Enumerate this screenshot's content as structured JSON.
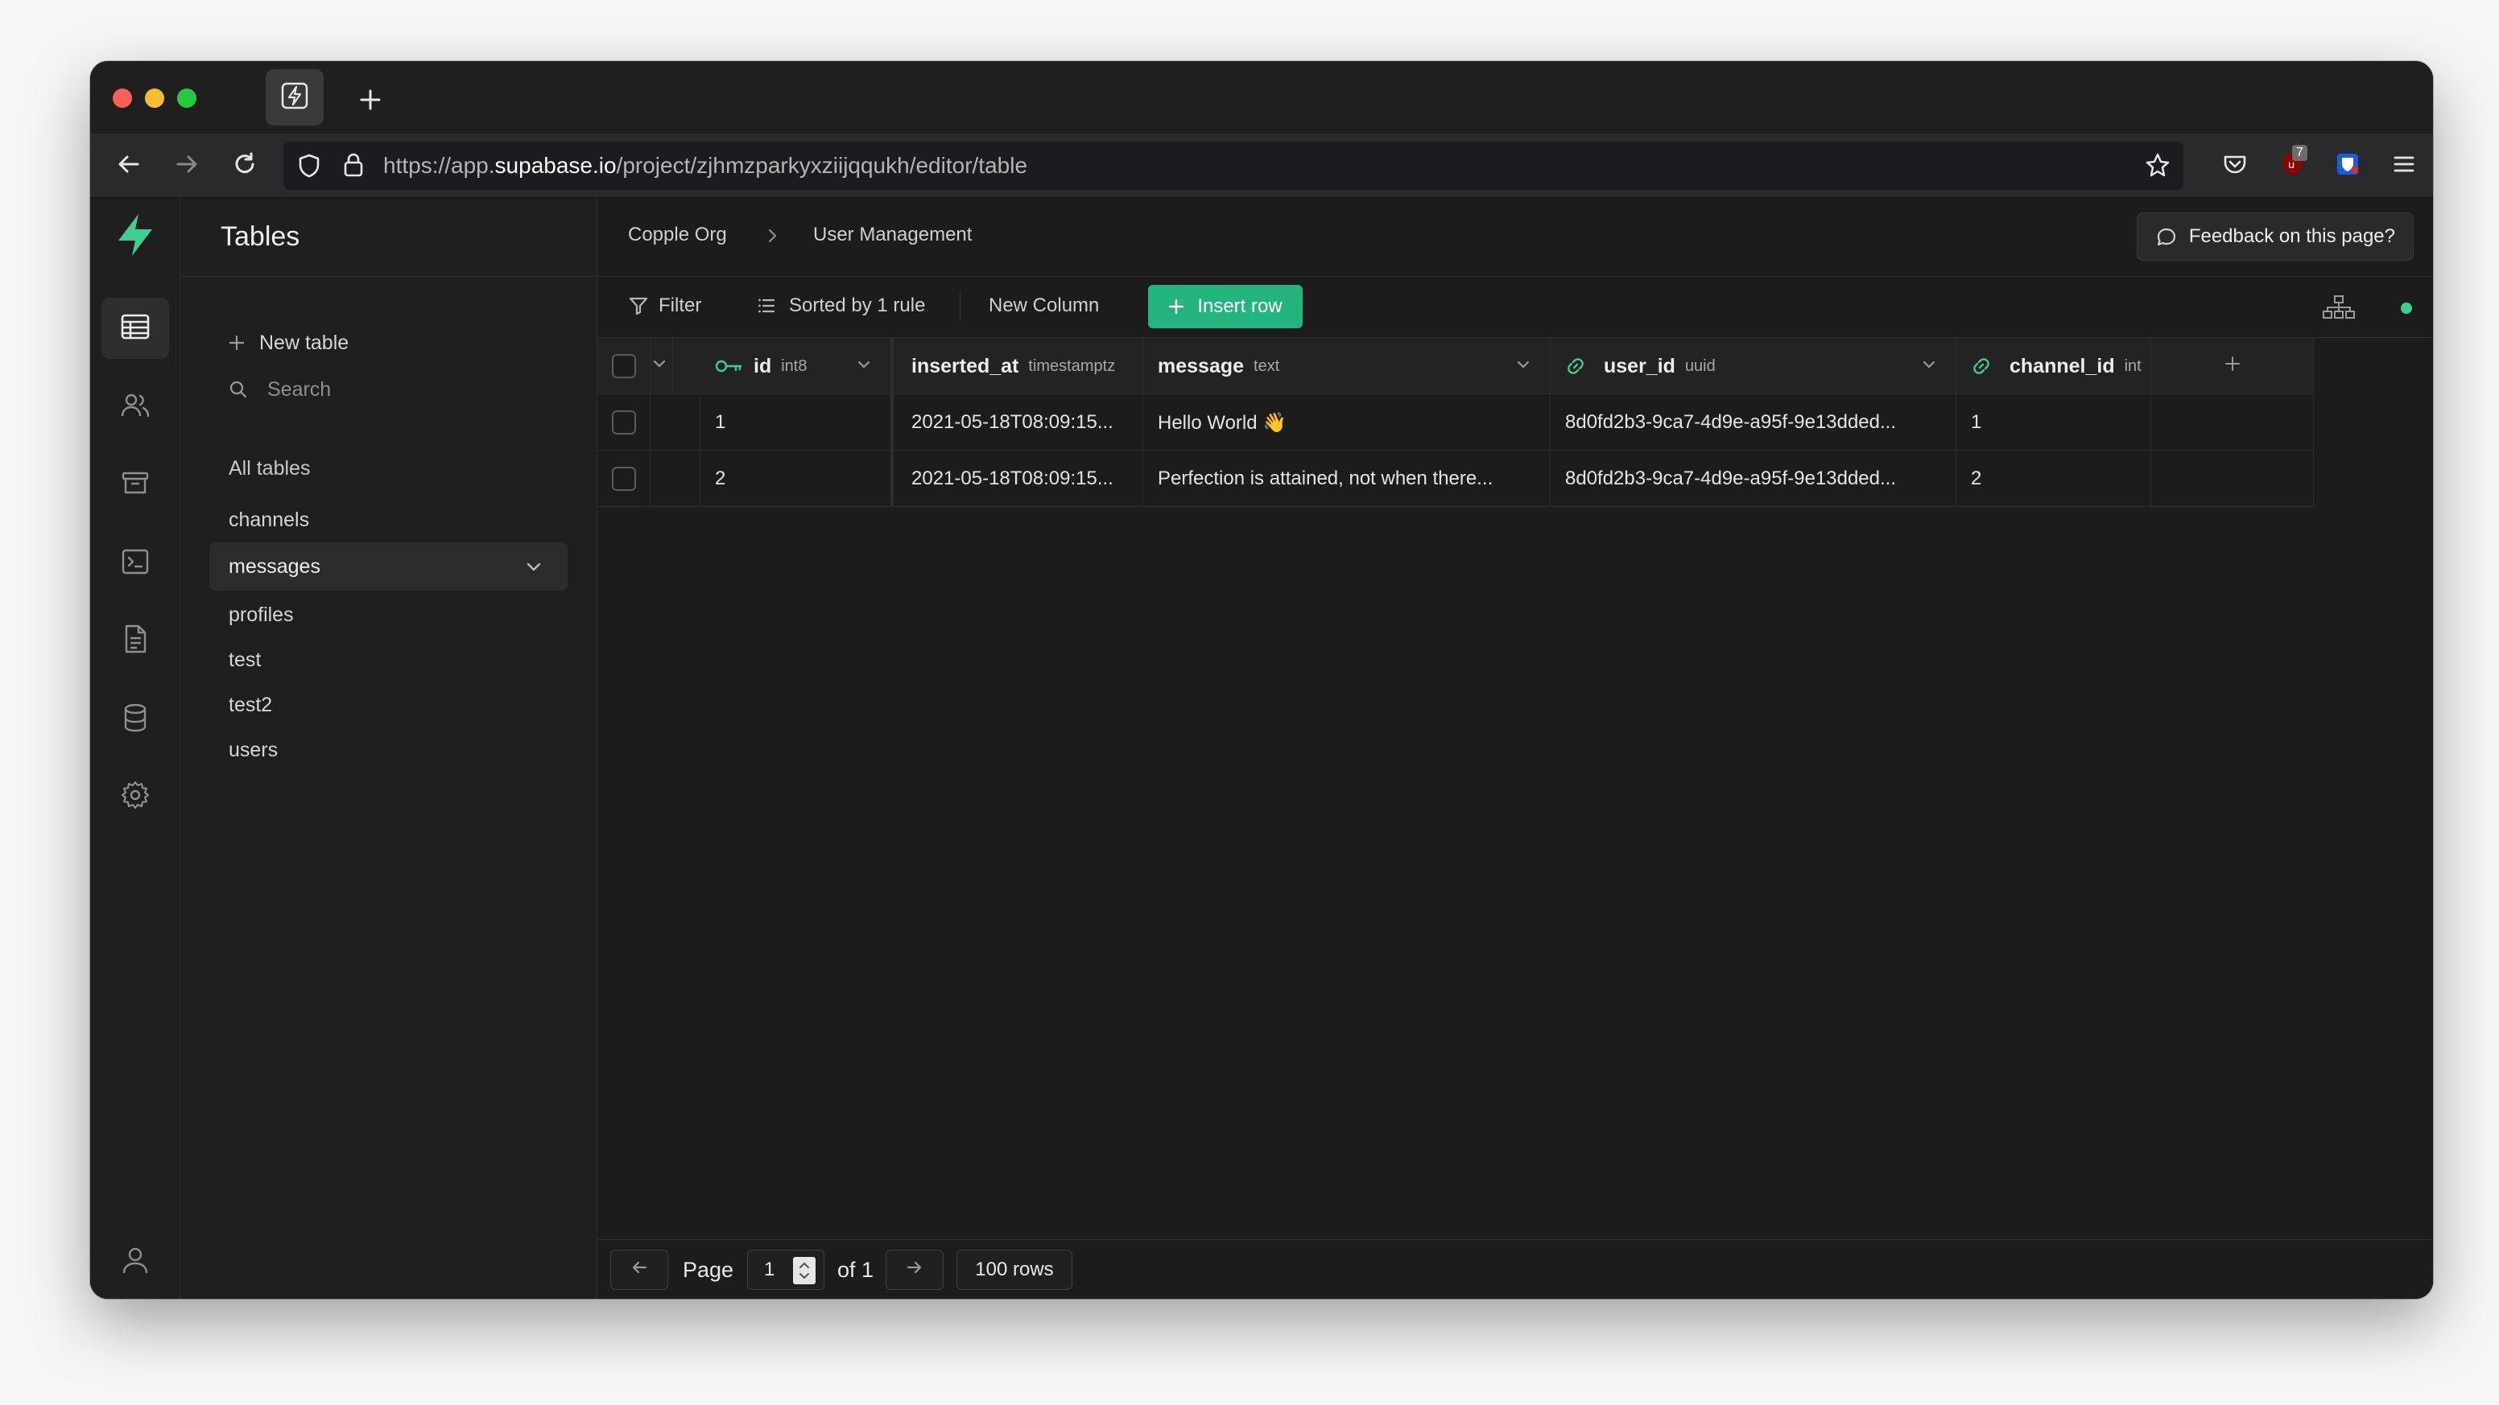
{
  "browser": {
    "url_prefix": "https://app.",
    "url_domain": "supabase.io",
    "url_path": "/project/zjhmzparkyxziijqqukh/editor/table",
    "extension_badge": "7"
  },
  "colors": {
    "accent": "#24b47e",
    "brand": "#3ecf8e",
    "status": "#3ecf8e"
  },
  "sidebar": {
    "title": "Tables",
    "new_table_label": "New table",
    "search_placeholder": "Search",
    "section_label": "All tables",
    "tables": [
      {
        "name": "channels"
      },
      {
        "name": "messages",
        "selected": true
      },
      {
        "name": "profiles"
      },
      {
        "name": "test"
      },
      {
        "name": "test2"
      },
      {
        "name": "users"
      }
    ]
  },
  "topbar": {
    "org": "Copple Org",
    "project": "User Management",
    "feedback_label": "Feedback on this page?"
  },
  "toolbar": {
    "filter_label": "Filter",
    "sort_label": "Sorted by 1 rule",
    "new_column_label": "New Column",
    "insert_row_label": "Insert row"
  },
  "grid": {
    "columns": [
      {
        "name": "id",
        "type": "int8"
      },
      {
        "name": "inserted_at",
        "type": "timestamptz"
      },
      {
        "name": "message",
        "type": "text"
      },
      {
        "name": "user_id",
        "type": "uuid"
      },
      {
        "name": "channel_id",
        "type": "int"
      }
    ],
    "rows": [
      {
        "id": "1",
        "inserted_at": "2021-05-18T08:09:15...",
        "message": "Hello World 👋",
        "user_id": "8d0fd2b3-9ca7-4d9e-a95f-9e13dded...",
        "channel_id": "1"
      },
      {
        "id": "2",
        "inserted_at": "2021-05-18T08:09:15...",
        "message": "Perfection is attained, not when there...",
        "user_id": "8d0fd2b3-9ca7-4d9e-a95f-9e13dded...",
        "channel_id": "2"
      }
    ]
  },
  "footer": {
    "page_label": "Page",
    "page_value": "1",
    "of_label": "of 1",
    "rows_label": "100 rows"
  }
}
